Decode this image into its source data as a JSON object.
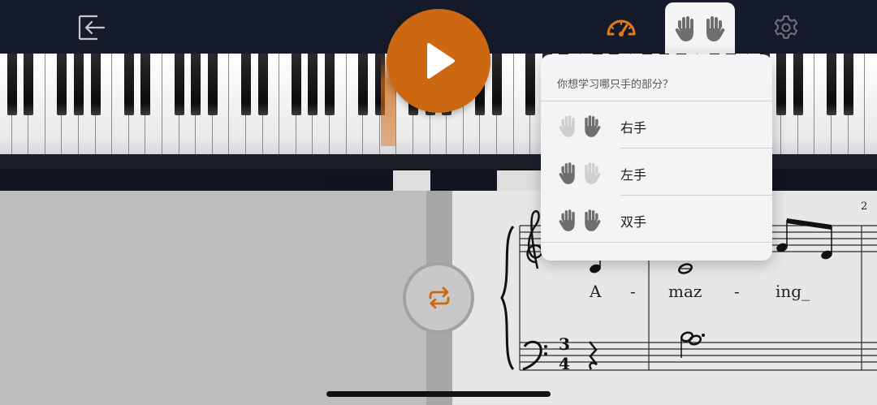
{
  "colors": {
    "accent": "#cd6812",
    "topbar": "#161b2b",
    "hand_active": "#6e6e70",
    "hand_inactive": "#cfcfd2"
  },
  "toolbar": {
    "exit_icon": "exit-arrow-icon",
    "speed_icon": "speedometer-icon",
    "hands_icon": "hands-icon",
    "settings_icon": "gear-icon"
  },
  "player": {
    "play_icon": "play-icon",
    "loop_icon": "loop-icon"
  },
  "hand_menu": {
    "question": "你想学习哪只手的部分？",
    "options": [
      {
        "label": "右手",
        "left_hand": "inactive",
        "right_hand": "active"
      },
      {
        "label": "左手",
        "left_hand": "active",
        "right_hand": "inactive"
      },
      {
        "label": "双手",
        "left_hand": "active",
        "right_hand": "active"
      }
    ]
  },
  "score": {
    "measure_number": "2",
    "lyrics": [
      "A",
      "-",
      "maz",
      "-",
      "ing_"
    ],
    "time_signature": "3/4"
  }
}
